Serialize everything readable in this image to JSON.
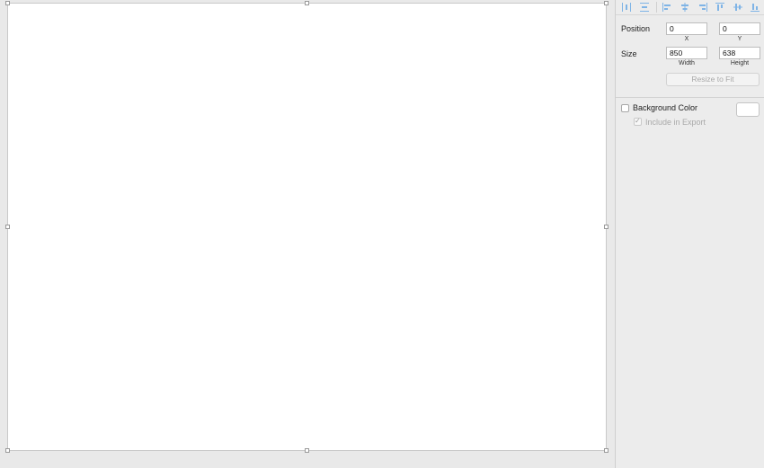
{
  "inspector": {
    "position": {
      "label": "Position",
      "x_value": "0",
      "y_value": "0",
      "x_caption": "X",
      "y_caption": "Y"
    },
    "size": {
      "label": "Size",
      "width_value": "850",
      "height_value": "638",
      "width_caption": "Width",
      "height_caption": "Height"
    },
    "resize_to_fit_label": "Resize to Fit",
    "background_color_label": "Background Color",
    "include_in_export_label": "Include in Export",
    "background_color_checked": false,
    "include_in_export_checked": true
  },
  "colors": {
    "artboard": "#ffffff",
    "canvas": "#e9e9e9",
    "inspector": "#ececec",
    "icon_accent": "#7fb4e6"
  },
  "toolbar_icons": [
    "distribute-horizontally-icon",
    "distribute-vertically-icon",
    "align-left-icon",
    "align-horizontal-center-icon",
    "align-right-icon",
    "align-top-icon",
    "align-vertical-middle-icon",
    "align-bottom-icon"
  ]
}
